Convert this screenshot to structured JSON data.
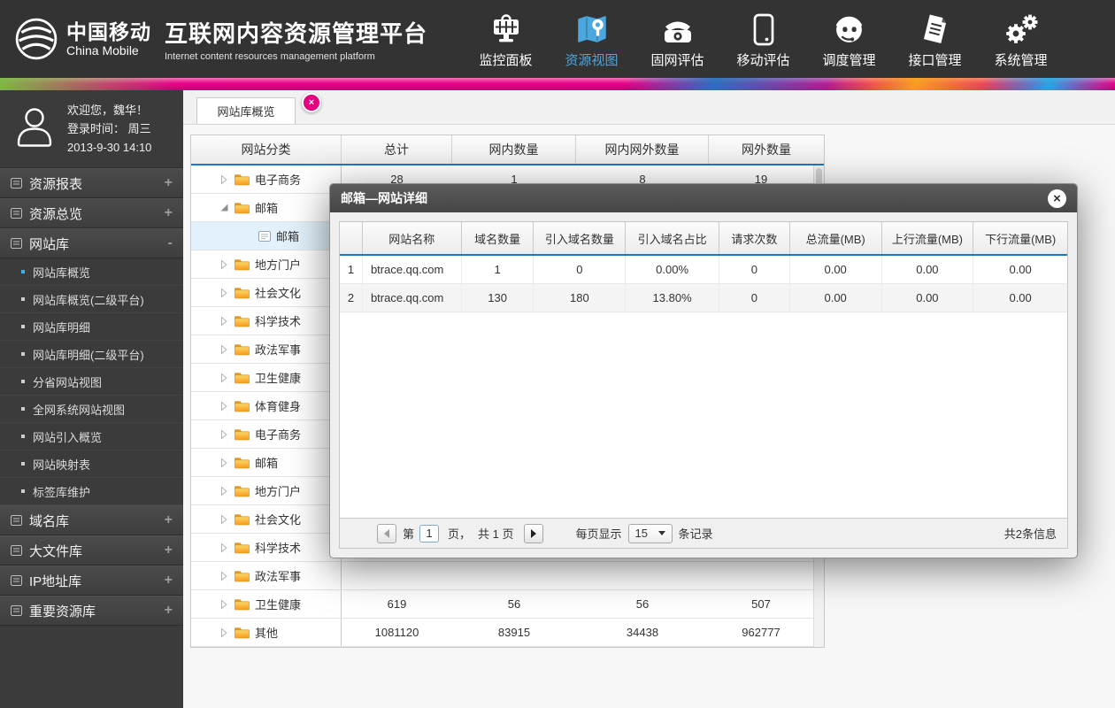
{
  "header": {
    "brand": {
      "name_cn": "中国移动",
      "name_en": "China Mobile",
      "platform_title": "互联网内容资源管理平台",
      "platform_subtitle": "Internet content resources management platform"
    },
    "nav": [
      {
        "id": "dashboard",
        "label": "监控面板",
        "icon": "dashboard-icon",
        "active": false
      },
      {
        "id": "map",
        "label": "资源视图",
        "icon": "map-icon",
        "active": true
      },
      {
        "id": "fixed-eval",
        "label": "固网评估",
        "icon": "phone-icon",
        "active": false
      },
      {
        "id": "mobile-eval",
        "label": "移动评估",
        "icon": "mobile-icon",
        "active": false
      },
      {
        "id": "dispatch",
        "label": "调度管理",
        "icon": "headset-icon",
        "active": false
      },
      {
        "id": "interface",
        "label": "接口管理",
        "icon": "document-icon",
        "active": false
      },
      {
        "id": "system",
        "label": "系统管理",
        "icon": "gears-icon",
        "active": false
      }
    ]
  },
  "sidebar": {
    "user": {
      "welcome": "欢迎您，魏华！",
      "login_line": "登录时间： 周三",
      "login_datetime": "2013-9-30  14:10"
    },
    "groups": [
      {
        "id": "resource-report",
        "label": "资源报表",
        "toggle": "+",
        "expanded": false,
        "items": []
      },
      {
        "id": "resource-overview",
        "label": "资源总览",
        "toggle": "+",
        "expanded": false,
        "items": []
      },
      {
        "id": "website-lib",
        "label": "网站库",
        "toggle": "-",
        "expanded": true,
        "items": [
          {
            "label": "网站库概览",
            "active": true
          },
          {
            "label": "网站库概览(二级平台)",
            "active": false
          },
          {
            "label": "网站库明细",
            "active": false
          },
          {
            "label": "网站库明细(二级平台)",
            "active": false
          },
          {
            "label": "分省网站视图",
            "active": false
          },
          {
            "label": "全网系统网站视图",
            "active": false
          },
          {
            "label": "网站引入概览",
            "active": false
          },
          {
            "label": "网站映射表",
            "active": false
          },
          {
            "label": "标签库维护",
            "active": false
          }
        ]
      },
      {
        "id": "domain-lib",
        "label": "域名库",
        "toggle": "+",
        "expanded": false,
        "items": []
      },
      {
        "id": "bigfile-lib",
        "label": "大文件库",
        "toggle": "+",
        "expanded": false,
        "items": []
      },
      {
        "id": "ip-lib",
        "label": "IP地址库",
        "toggle": "+",
        "expanded": false,
        "items": []
      },
      {
        "id": "key-resource",
        "label": "重要资源库",
        "toggle": "+",
        "expanded": false,
        "items": []
      }
    ]
  },
  "main": {
    "tab_label": "网站库概览",
    "category_table": {
      "columns": [
        "网站分类",
        "总计",
        "网内数量",
        "网内网外数量",
        "网外数量"
      ],
      "rows": [
        {
          "label": "电子商务",
          "icon": "folder",
          "arrow": "collapsed",
          "child": false,
          "selected": false,
          "values": [
            "28",
            "1",
            "8",
            "19"
          ]
        },
        {
          "label": "邮箱",
          "icon": "folder",
          "arrow": "expanded",
          "child": false,
          "selected": false,
          "values": [
            "",
            "",
            "",
            ""
          ]
        },
        {
          "label": "邮箱",
          "icon": "doc",
          "arrow": "none",
          "child": true,
          "selected": true,
          "values": [
            "",
            "",
            "",
            ""
          ]
        },
        {
          "label": "地方门户",
          "icon": "folder",
          "arrow": "collapsed",
          "child": false,
          "selected": false,
          "values": [
            "",
            "",
            "",
            ""
          ]
        },
        {
          "label": "社会文化",
          "icon": "folder",
          "arrow": "collapsed",
          "child": false,
          "selected": false,
          "values": [
            "",
            "",
            "",
            ""
          ]
        },
        {
          "label": "科学技术",
          "icon": "folder",
          "arrow": "collapsed",
          "child": false,
          "selected": false,
          "values": [
            "",
            "",
            "",
            ""
          ]
        },
        {
          "label": "政法军事",
          "icon": "folder",
          "arrow": "collapsed",
          "child": false,
          "selected": false,
          "values": [
            "",
            "",
            "",
            ""
          ]
        },
        {
          "label": "卫生健康",
          "icon": "folder",
          "arrow": "collapsed",
          "child": false,
          "selected": false,
          "values": [
            "",
            "",
            "",
            ""
          ]
        },
        {
          "label": "体育健身",
          "icon": "folder",
          "arrow": "collapsed",
          "child": false,
          "selected": false,
          "values": [
            "",
            "",
            "",
            ""
          ]
        },
        {
          "label": "电子商务",
          "icon": "folder",
          "arrow": "collapsed",
          "child": false,
          "selected": false,
          "values": [
            "",
            "",
            "",
            ""
          ]
        },
        {
          "label": "邮箱",
          "icon": "folder",
          "arrow": "collapsed",
          "child": false,
          "selected": false,
          "values": [
            "",
            "",
            "",
            ""
          ]
        },
        {
          "label": "地方门户",
          "icon": "folder",
          "arrow": "collapsed",
          "child": false,
          "selected": false,
          "values": [
            "",
            "",
            "",
            ""
          ]
        },
        {
          "label": "社会文化",
          "icon": "folder",
          "arrow": "collapsed",
          "child": false,
          "selected": false,
          "values": [
            "",
            "",
            "",
            ""
          ]
        },
        {
          "label": "科学技术",
          "icon": "folder",
          "arrow": "collapsed",
          "child": false,
          "selected": false,
          "values": [
            "",
            "",
            "",
            ""
          ]
        },
        {
          "label": "政法军事",
          "icon": "folder",
          "arrow": "collapsed",
          "child": false,
          "selected": false,
          "values": [
            "",
            "",
            "",
            ""
          ]
        },
        {
          "label": "卫生健康",
          "icon": "folder",
          "arrow": "collapsed",
          "child": false,
          "selected": false,
          "values": [
            "619",
            "56",
            "56",
            "507"
          ]
        },
        {
          "label": "其他",
          "icon": "folder",
          "arrow": "collapsed",
          "child": false,
          "selected": false,
          "values": [
            "1081120",
            "83915",
            "34438",
            "962777"
          ]
        }
      ]
    }
  },
  "modal": {
    "title": "邮箱—网站详细",
    "close_icon": "close-icon",
    "detail_table": {
      "columns": [
        "",
        "网站名称",
        "域名数量",
        "引入域名数量",
        "引入域名占比",
        "请求次数",
        "总流量(MB)",
        "上行流量(MB)",
        "下行流量(MB)"
      ],
      "rows": [
        [
          "1",
          "btrace.qq.com",
          "1",
          "0",
          "0.00%",
          "0",
          "0.00",
          "0.00",
          "0.00"
        ],
        [
          "2",
          "btrace.qq.com",
          "130",
          "180",
          "13.80%",
          "0",
          "0.00",
          "0.00",
          "0.00"
        ]
      ]
    },
    "pagination": {
      "prev_icon": "chevron-left-icon",
      "page_label_before": "第",
      "current_page": "1",
      "page_label_after": "页，",
      "total_pages": "共 1 页",
      "next_icon": "chevron-right-icon",
      "per_page_label": "每页显示",
      "per_page_value": "15",
      "per_page_caret": "caret-down-icon",
      "per_page_unit": "条记录",
      "summary": "共2条信息"
    }
  },
  "colors": {
    "accent_blue": "#1b7ac2",
    "tab_close_pink": "#e4007f",
    "nav_active_blue": "#4aa8de",
    "folder_orange": "#f5a21e",
    "header_dark": "#333333",
    "sidebar_dark": "#3b3b3b"
  }
}
